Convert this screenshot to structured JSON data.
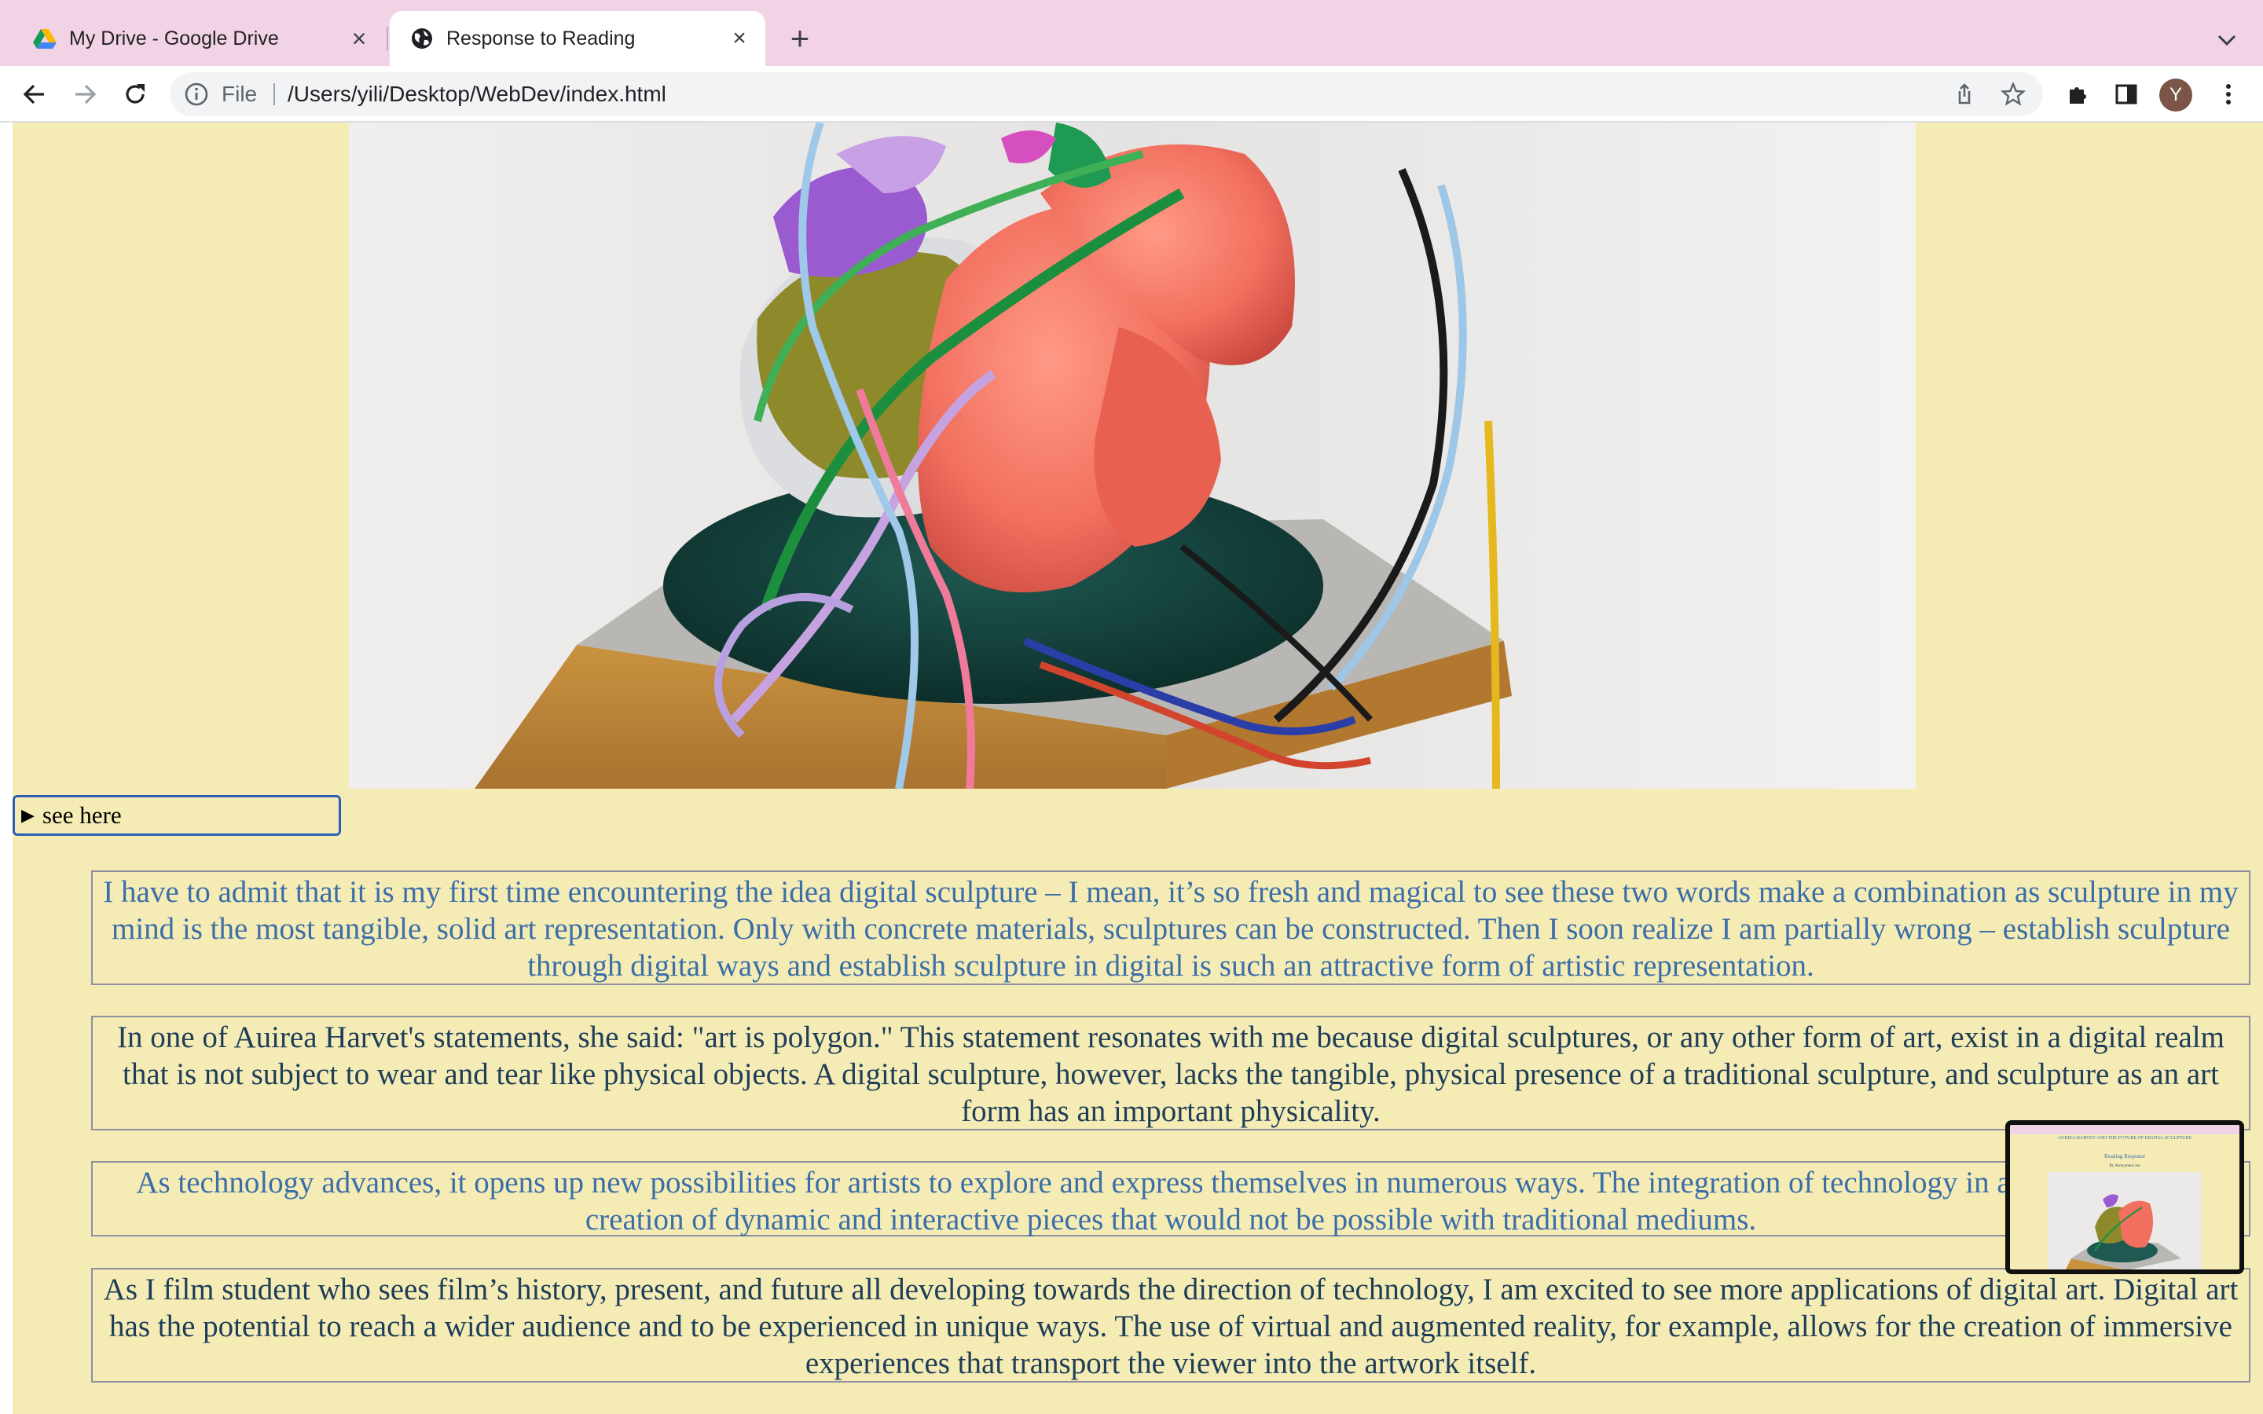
{
  "browser": {
    "tabs": [
      {
        "title": "My Drive - Google Drive",
        "favicon": "google-drive-icon",
        "active": false
      },
      {
        "title": "Response to Reading",
        "favicon": "globe-icon",
        "active": true
      }
    ],
    "address_bar": {
      "scheme_label": "File",
      "url": "/Users/yili/Desktop/WebDev/index.html"
    },
    "profile_initial": "Y"
  },
  "page": {
    "details_summary": "see here",
    "paragraphs": [
      {
        "style": "blue",
        "text": "I have to admit that it is my first time encountering the idea digital sculpture – I mean, it’s so fresh and magical to see these two words make a combination as sculpture in my mind is the most tangible, solid art representation. Only with concrete materials, sculptures can be constructed. Then I soon realize I am partially wrong – establish sculpture through digital ways and establish sculpture in digital is such an attractive form of artistic representation."
      },
      {
        "style": "dark",
        "text": "In one of Auirea Harvet's statements, she said: \"art is polygon.\" This statement resonates with me because digital sculptures, or any other form of art, exist in a digital realm that is not subject to wear and tear like physical objects. A digital sculpture, however, lacks the tangible, physical presence of a traditional sculpture, and sculpture as an art form has an important physicality."
      },
      {
        "style": "blue",
        "text": "As technology advances, it opens up new possibilities for artists to explore and express themselves in numerous ways. The integration of technology in art allows for the creation of dynamic and interactive pieces that would not be possible with traditional mediums."
      },
      {
        "style": "dark",
        "text": "As I film student who sees film’s history, present, and future all developing towards the direction of technology, I am excited to see more applications of digital art. Digital art has the potential to reach a wider audience and to be experienced in unique ways. The use of virtual and augmented reality, for example, allows for the creation of immersive experiences that transport the viewer into the artwork itself."
      }
    ],
    "thumbnail": {
      "header": "AURIEA HARVEY AND THE FUTURE OF DIGITAL SCULPTURE",
      "subtitle": "Reading Response",
      "byline": "By Anonymous Joe"
    }
  },
  "colors": {
    "page_background": "#f5ecb5",
    "tabstrip_background": "#f2d3e6",
    "paragraph_blue": "#3b6ea8",
    "paragraph_dark": "#1e3d58",
    "focus_ring": "#2b5fb8"
  }
}
